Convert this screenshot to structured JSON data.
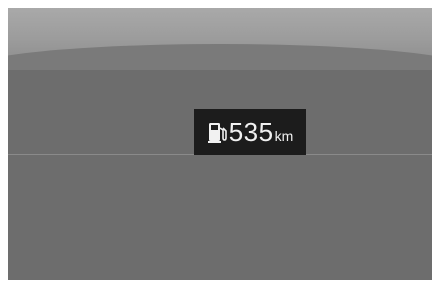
{
  "fuel_range": {
    "icon": "fuel-pump-icon",
    "value": "535",
    "unit": "km"
  }
}
